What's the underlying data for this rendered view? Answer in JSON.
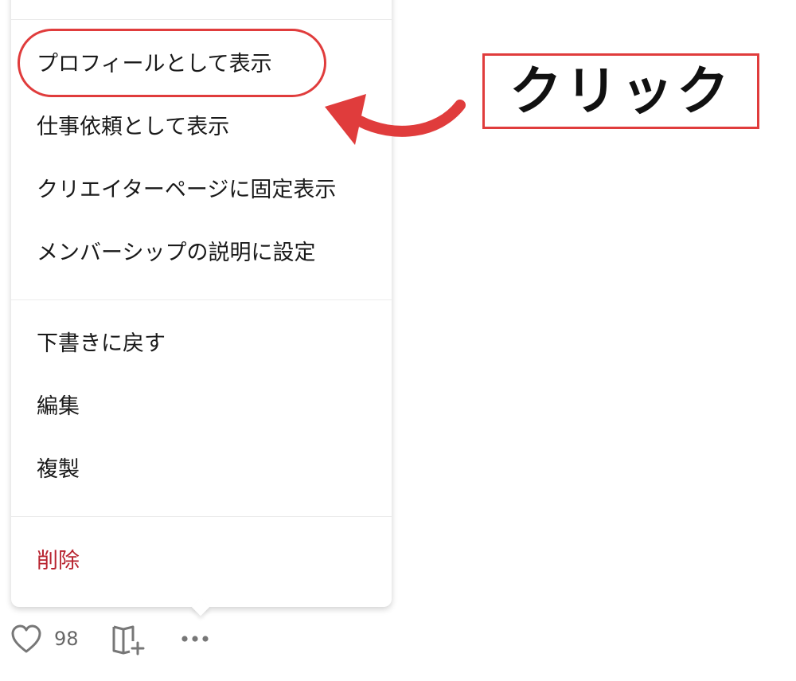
{
  "menu": {
    "group1": [
      "プロフィールとして表示",
      "仕事依頼として表示",
      "クリエイターページに固定表示",
      "メンバーシップの説明に設定"
    ],
    "group2": [
      "下書きに戻す",
      "編集",
      "複製"
    ],
    "danger_item": "削除"
  },
  "annotation": {
    "callout_text": "クリック",
    "accent_color": "#e03c3c"
  },
  "action_bar": {
    "like_icon": "heart-icon",
    "like_count": "98",
    "bookmark_icon": "book-add-icon",
    "more_icon": "more-horizontal-icon"
  },
  "colors": {
    "danger_text": "#b8232f",
    "menu_text": "#1a1a1a",
    "icon_gray": "#777777"
  }
}
